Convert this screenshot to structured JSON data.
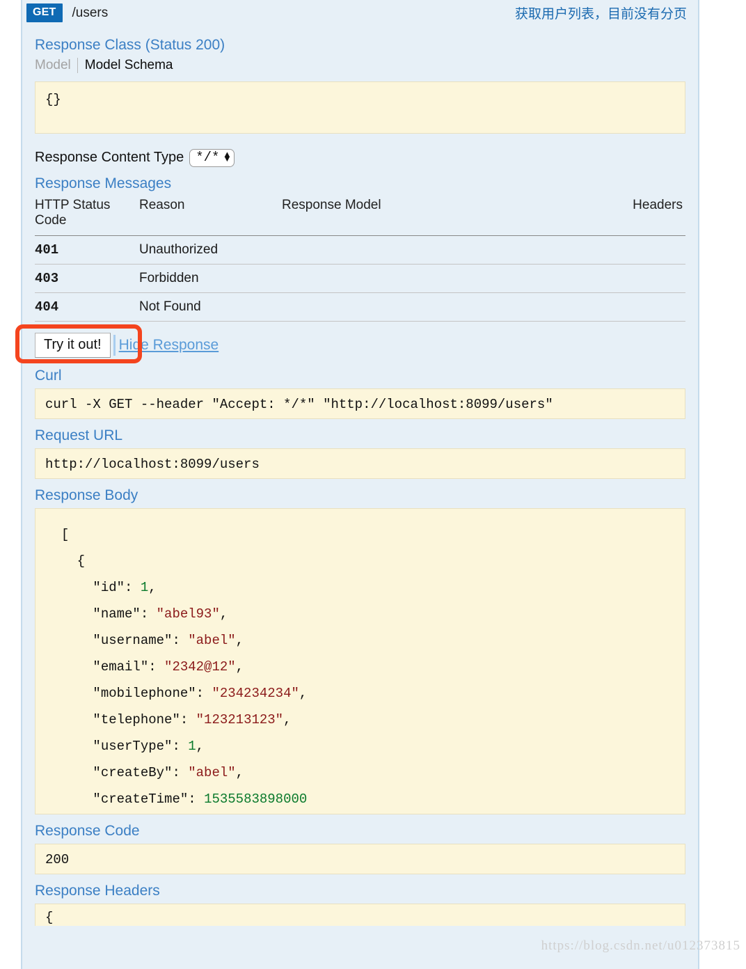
{
  "operation": {
    "method": "GET",
    "path": "/users",
    "summary": "获取用户列表，目前没有分页"
  },
  "response_class": {
    "title": "Response Class (Status 200)",
    "tab_model": "Model",
    "tab_model_schema": "Model Schema",
    "schema_body": "{}"
  },
  "content_type": {
    "label": "Response Content Type",
    "value": "*/*"
  },
  "response_messages": {
    "title": "Response Messages",
    "columns": {
      "code": "HTTP Status Code",
      "reason": "Reason",
      "model": "Response Model",
      "headers": "Headers"
    },
    "rows": [
      {
        "code": "401",
        "reason": "Unauthorized",
        "model": "",
        "headers": ""
      },
      {
        "code": "403",
        "reason": "Forbidden",
        "model": "",
        "headers": ""
      },
      {
        "code": "404",
        "reason": "Not Found",
        "model": "",
        "headers": ""
      }
    ]
  },
  "actions": {
    "try_it_out": "Try it out!",
    "hide_response": "Hide Response",
    "highlight_color": "#f4441e"
  },
  "curl": {
    "title": "Curl",
    "command": "curl -X GET --header \"Accept: */*\" \"http://localhost:8099/users\""
  },
  "request_url": {
    "title": "Request URL",
    "url": "http://localhost:8099/users"
  },
  "response_body": {
    "title": "Response Body",
    "lines": [
      {
        "indent": 1,
        "parts": [
          {
            "t": "[",
            "c": "punc"
          }
        ]
      },
      {
        "indent": 2,
        "parts": [
          {
            "t": "{",
            "c": "punc"
          }
        ]
      },
      {
        "indent": 3,
        "parts": [
          {
            "t": "\"id\": ",
            "c": "key"
          },
          {
            "t": "1",
            "c": "num"
          },
          {
            "t": ",",
            "c": "punc"
          }
        ]
      },
      {
        "indent": 3,
        "parts": [
          {
            "t": "\"name\": ",
            "c": "key"
          },
          {
            "t": "\"abel93\"",
            "c": "str"
          },
          {
            "t": ",",
            "c": "punc"
          }
        ]
      },
      {
        "indent": 3,
        "parts": [
          {
            "t": "\"username\": ",
            "c": "key"
          },
          {
            "t": "\"abel\"",
            "c": "str"
          },
          {
            "t": ",",
            "c": "punc"
          }
        ]
      },
      {
        "indent": 3,
        "parts": [
          {
            "t": "\"email\": ",
            "c": "key"
          },
          {
            "t": "\"2342@12\"",
            "c": "str"
          },
          {
            "t": ",",
            "c": "punc"
          }
        ]
      },
      {
        "indent": 3,
        "parts": [
          {
            "t": "\"mobilephone\": ",
            "c": "key"
          },
          {
            "t": "\"234234234\"",
            "c": "str"
          },
          {
            "t": ",",
            "c": "punc"
          }
        ]
      },
      {
        "indent": 3,
        "parts": [
          {
            "t": "\"telephone\": ",
            "c": "key"
          },
          {
            "t": "\"123213123\"",
            "c": "str"
          },
          {
            "t": ",",
            "c": "punc"
          }
        ]
      },
      {
        "indent": 3,
        "parts": [
          {
            "t": "\"userType\": ",
            "c": "key"
          },
          {
            "t": "1",
            "c": "num"
          },
          {
            "t": ",",
            "c": "punc"
          }
        ]
      },
      {
        "indent": 3,
        "parts": [
          {
            "t": "\"createBy\": ",
            "c": "key"
          },
          {
            "t": "\"abel\"",
            "c": "str"
          },
          {
            "t": ",",
            "c": "punc"
          }
        ]
      },
      {
        "indent": 3,
        "parts": [
          {
            "t": "\"createTime\": ",
            "c": "key"
          },
          {
            "t": "1535583898000",
            "c": "num"
          }
        ]
      }
    ]
  },
  "response_code": {
    "title": "Response Code",
    "value": "200"
  },
  "response_headers": {
    "title": "Response Headers",
    "first_line": "{"
  },
  "watermark": "https://blog.csdn.net/u012373815"
}
